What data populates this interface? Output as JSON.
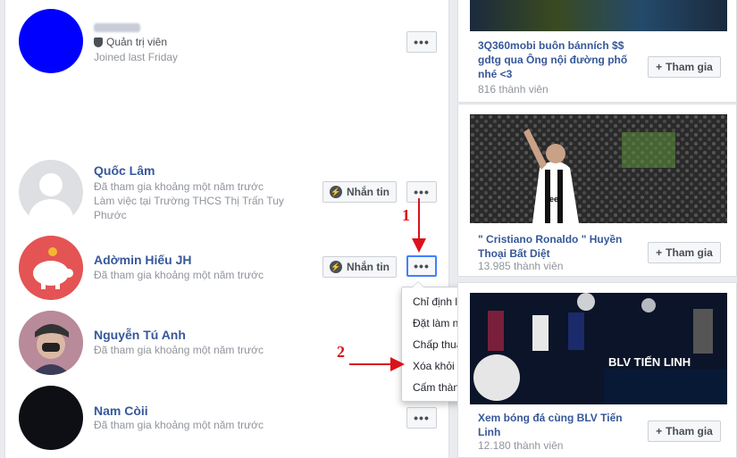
{
  "members": [
    {
      "name": "",
      "role": "Quản trị viên",
      "sub": "Joined last Friday",
      "more": "•••"
    },
    {
      "name": "Quốc Lâm",
      "sub": "Đã tham gia khoảng một năm trước",
      "sub2": "Làm việc tại Trường THCS Thị Trấn Tuy Phước",
      "message": "Nhắn tin",
      "more": "•••"
    },
    {
      "name": "Adờmin Hiếu JH",
      "sub": "Đã tham gia khoảng một năm trước",
      "message": "Nhắn tin",
      "more": "•••"
    },
    {
      "name": "Nguyễn Tú Anh",
      "sub": "Đã tham gia khoảng một năm trước"
    },
    {
      "name": "Nam Còii",
      "sub": "Đã tham gia khoảng một năm trước",
      "more": "•••"
    }
  ],
  "menu": {
    "items": [
      "Chỉ định làm quản trị viên",
      "Đặt làm người kiểm duyệt",
      "Chấp thuận trước bài viết",
      "Xóa khỏi nhóm",
      "Cấm thành viên đăng"
    ]
  },
  "annotations": {
    "step1": "1",
    "step2": "2",
    "color": "#d9121c"
  },
  "groups": [
    {
      "name": "3Q360mobi buôn bánních $$ gdtg qua Ông nội đường phố nhé <3",
      "members": "816 thành viên",
      "join": "Tham gia"
    },
    {
      "name": "\" Cristiano Ronaldo \" Huyền Thoại Bất Diệt",
      "members": "13.985 thành viên",
      "join": "Tham gia"
    },
    {
      "name": "Xem bóng đá cùng BLV Tiến Linh",
      "members": "12.180 thành viên",
      "join": "Tham gia",
      "banner": "BLV TIẾN LINH"
    }
  ],
  "colors": {
    "link": "#365899",
    "muted": "#90949c",
    "annotation": "#d9121c",
    "focus": "#4080ff"
  }
}
